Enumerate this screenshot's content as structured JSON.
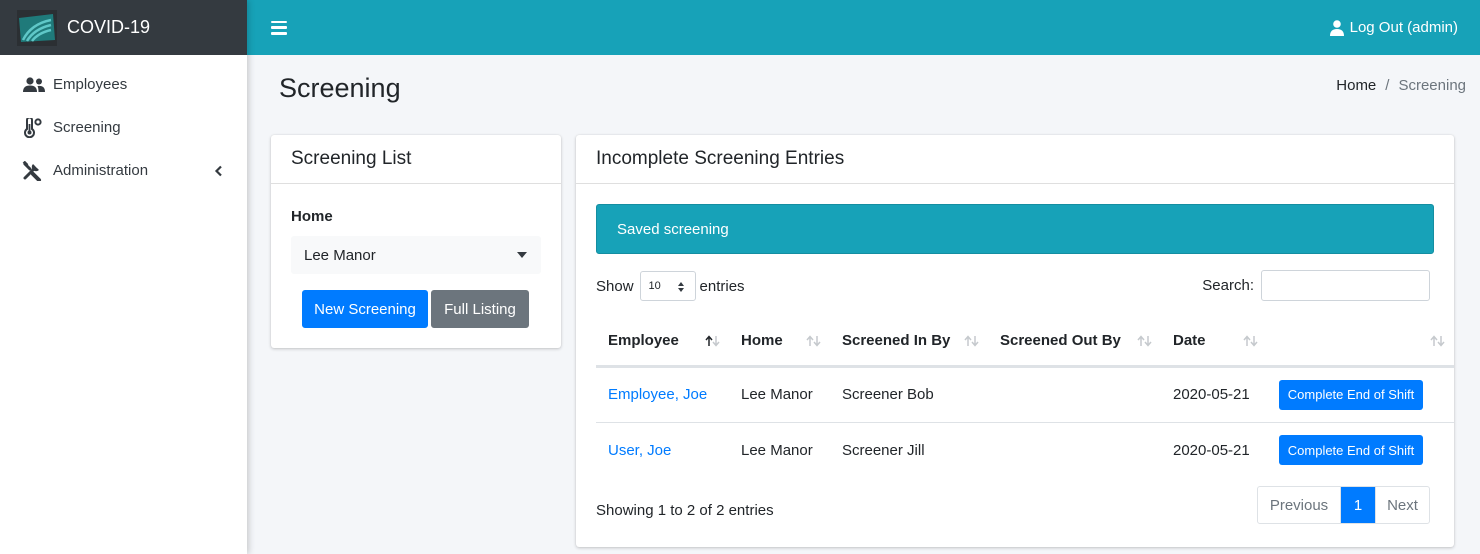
{
  "brand": {
    "title": "COVID-19",
    "logo_icon": "covid-logo-icon"
  },
  "sidebar": {
    "items": [
      {
        "label": "Employees",
        "icon": "users-icon"
      },
      {
        "label": "Screening",
        "icon": "thermometer-icon"
      },
      {
        "label": "Administration",
        "icon": "tools-icon"
      }
    ]
  },
  "topbar": {
    "menu_icon": "hamburger-icon",
    "logout_label": "Log Out (admin)",
    "accent": "#17a2b8"
  },
  "header": {
    "title": "Screening",
    "breadcrumb": [
      "Home",
      "Screening"
    ]
  },
  "screening_list": {
    "title": "Screening List",
    "home_label": "Home",
    "home_selected": "Lee Manor",
    "new_button": "New Screening",
    "full_button": "Full Listing"
  },
  "entries": {
    "title": "Incomplete Screening Entries",
    "alert": "Saved screening",
    "show_label": "Show",
    "page_length": "10",
    "entries_label": "entries",
    "search_label": "Search:",
    "search_value": "",
    "columns": [
      "Employee",
      "Home",
      "Screened In By",
      "Screened Out By",
      "Date",
      ""
    ],
    "rows": [
      {
        "employee": "Employee, Joe",
        "home": "Lee Manor",
        "screened_in": "Screener Bob",
        "screened_out": "",
        "date": "2020-05-21",
        "action": "Complete End of Shift"
      },
      {
        "employee": "User, Joe",
        "home": "Lee Manor",
        "screened_in": "Screener Jill",
        "screened_out": "",
        "date": "2020-05-21",
        "action": "Complete End of Shift"
      }
    ],
    "info": "Showing 1 to 2 of 2 entries",
    "pagination": {
      "previous": "Previous",
      "current": "1",
      "next": "Next"
    }
  }
}
